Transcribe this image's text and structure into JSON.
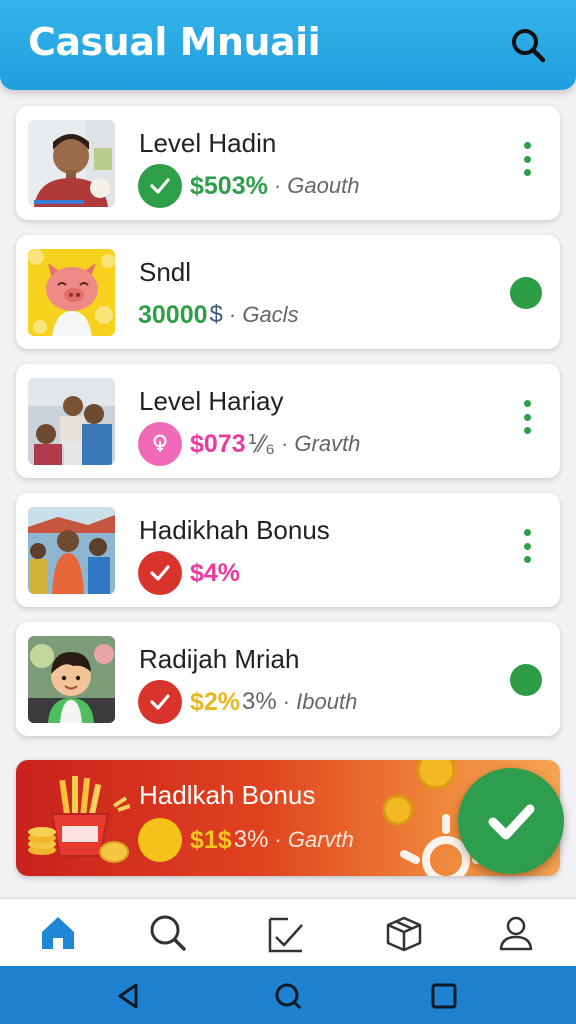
{
  "app": {
    "title": "Casual Mnuaii"
  },
  "header": {
    "search_icon": "search-icon"
  },
  "colors": {
    "header": "#1f9fdf",
    "green": "#2e9e48",
    "pink": "#ee3aa0",
    "yellow": "#e8b81e",
    "red": "#d9342b",
    "nav_active": "#1e88d6",
    "system_bar": "#1f82d1"
  },
  "list": [
    {
      "title": "Level Hadin",
      "amount": "$503%",
      "amount_suffix": "",
      "meta": "· Gaouth",
      "badge_icon": "check-icon",
      "badge_color": "#2e9e48",
      "amount_color": "#2e9e48",
      "trailing": "more-options"
    },
    {
      "title": "Sndl",
      "amount": "30000",
      "amount_suffix": "$",
      "meta": "· Gacls",
      "badge_icon": "",
      "badge_color": "",
      "amount_color": "#2e9e48",
      "trailing": "status-dot"
    },
    {
      "title": "Level Hariay",
      "amount": "$073",
      "amount_suffix": "⅟⁄₆",
      "meta": "· Gravth",
      "badge_icon": "lightbulb-icon",
      "badge_color": "#ee3aa0",
      "amount_color": "#ee3aa0",
      "trailing": "more-options"
    },
    {
      "title": "Hadikhah Bonus",
      "amount": "$4%",
      "amount_suffix": "",
      "meta": "",
      "badge_icon": "check-icon",
      "badge_color": "#d9342b",
      "amount_color": "#ee3aa0",
      "trailing": "more-options"
    },
    {
      "title": "Radijah Mriah",
      "amount": "$2%",
      "amount_suffix": "3%",
      "meta": "· Ibouth",
      "badge_icon": "check-icon",
      "badge_color": "#d9342b",
      "amount_color": "#e8b81e",
      "trailing": "status-dot"
    }
  ],
  "promo": {
    "title": "Hadlkah Bonus",
    "amount": "$1$",
    "amount_suffix": "3%",
    "meta": "· Garvth",
    "badge_color": "#f4c21a",
    "amount_color": "#f6c623"
  },
  "fab": {
    "icon": "check-icon"
  },
  "bottom_nav": [
    {
      "name": "home",
      "icon": "home-icon",
      "active": true
    },
    {
      "name": "search",
      "icon": "search-icon",
      "active": false
    },
    {
      "name": "tasks",
      "icon": "checklist-icon",
      "active": false
    },
    {
      "name": "packages",
      "icon": "box-icon",
      "active": false
    },
    {
      "name": "profile",
      "icon": "person-icon",
      "active": false
    }
  ],
  "system_nav": [
    "back-icon",
    "home-circle-icon",
    "recents-icon"
  ]
}
